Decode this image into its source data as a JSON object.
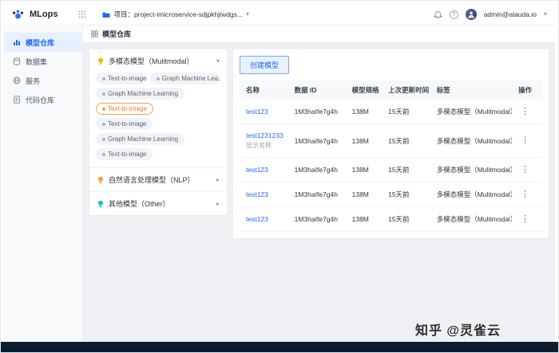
{
  "header": {
    "app_name": "MLops",
    "project_label": "项目：project-imicroservice-sdjpkhjiwdgs...",
    "user_email": "admin@alauda.io"
  },
  "icons": {
    "chevron_down": "▾",
    "chevron_right": "▸",
    "kebab": "⋮",
    "help": "?"
  },
  "sidebar": {
    "items": [
      {
        "label": "模型仓库",
        "active": true
      },
      {
        "label": "数据集",
        "active": false
      },
      {
        "label": "服务",
        "active": false
      },
      {
        "label": "代码仓库",
        "active": false
      }
    ]
  },
  "page": {
    "title": "模型仓库"
  },
  "categories": {
    "groups": [
      {
        "label": "多模态模型（Mulitmodal）",
        "expanded": true
      },
      {
        "label": "自然语言处理模型（NLP）",
        "expanded": false
      },
      {
        "label": "其他模型（Other）",
        "expanded": false
      }
    ],
    "tags": [
      {
        "label": "Text-to-image",
        "active": false
      },
      {
        "label": "Graph Machine Lea...",
        "active": false
      },
      {
        "label": "Graph Machine Learning",
        "active": false
      },
      {
        "label": "Text-to-Image",
        "active": true
      },
      {
        "label": "Text-to-image",
        "active": false
      },
      {
        "label": "Graph Machine Learning",
        "active": false
      },
      {
        "label": "Text-to-image",
        "active": false
      }
    ]
  },
  "toolbar": {
    "create_label": "创建模型"
  },
  "table": {
    "columns": [
      "名称",
      "数据 ID",
      "模型规格",
      "上次更新时间",
      "标签",
      "操作"
    ],
    "rows": [
      {
        "name": "test123",
        "display_name": "",
        "data_id": "1M3haIfe7g4h",
        "spec": "138M",
        "updated": "15天前",
        "tag": "多模态模型（Mulitmodal）"
      },
      {
        "name": "test1231233",
        "display_name": "显示名称",
        "data_id": "1M3haIfe7g4h",
        "spec": "138M",
        "updated": "15天前",
        "tag": "多模态模型（Mulitmodal）"
      },
      {
        "name": "test123",
        "display_name": "",
        "data_id": "1M3haIfe7g4h",
        "spec": "138M",
        "updated": "15天前",
        "tag": "多模态模型（Mulitmodal）"
      },
      {
        "name": "test123",
        "display_name": "",
        "data_id": "1M3haIfe7g4h",
        "spec": "138M",
        "updated": "15天前",
        "tag": "多模态模型（Mulitmodal）"
      },
      {
        "name": "test123",
        "display_name": "",
        "data_id": "1M3haIfe7g4h",
        "spec": "138M",
        "updated": "15天前",
        "tag": "多模态模型（Mulitmodal）"
      }
    ]
  },
  "watermark": "知乎 @灵雀云",
  "colors": {
    "primary": "#2468f2",
    "sidebar_active_bg": "#e6f0ff",
    "tag_active": "#ff9b4a",
    "footer_bar": "#0c1c30",
    "bulb_multimodal": "#f7b500",
    "bulb_nlp": "#ff9b2f",
    "bulb_other": "#0fc6c2"
  }
}
